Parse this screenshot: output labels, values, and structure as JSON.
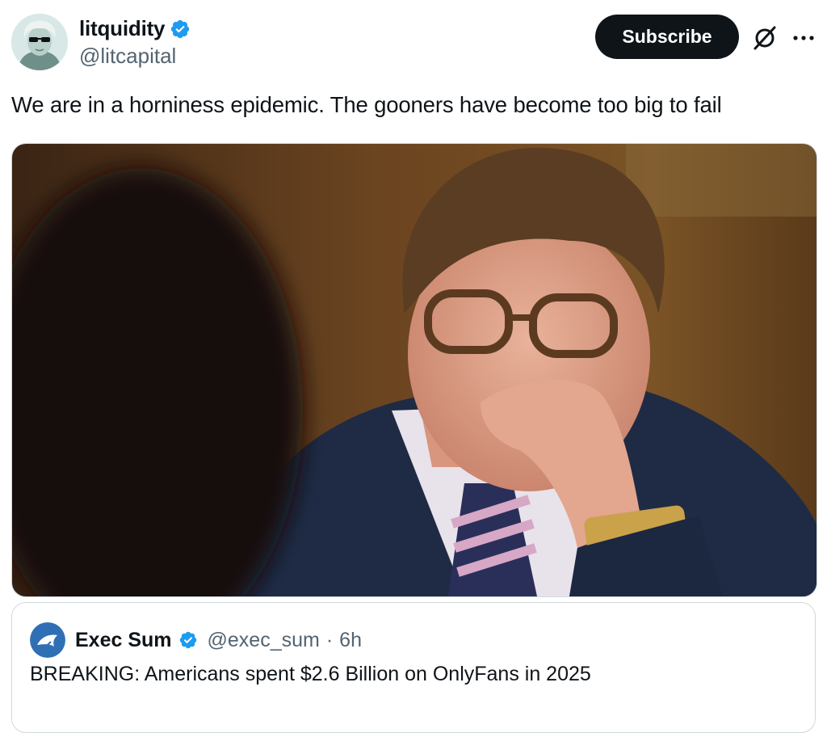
{
  "author": {
    "display_name": "litquidity",
    "handle": "@litcapital",
    "verified": true,
    "avatar_icon": "avatar-washington-sunglasses"
  },
  "actions": {
    "subscribe_label": "Subscribe",
    "grok_icon": "grok-icon",
    "more_icon": "more-icon"
  },
  "tweet": {
    "text": "We are in a horniness epidemic. The gooners have become too big to fail"
  },
  "media": {
    "type": "photo"
  },
  "quote": {
    "display_name": "Exec Sum",
    "handle": "@exec_sum",
    "separator": "·",
    "time": "6h",
    "verified": true,
    "text": "BREAKING: Americans spent $2.6 Billion on OnlyFans in 2025"
  },
  "colors": {
    "verified": "#1d9bf0",
    "text_primary": "#0f1419",
    "text_secondary": "#536471",
    "button_bg": "#0f1419"
  }
}
